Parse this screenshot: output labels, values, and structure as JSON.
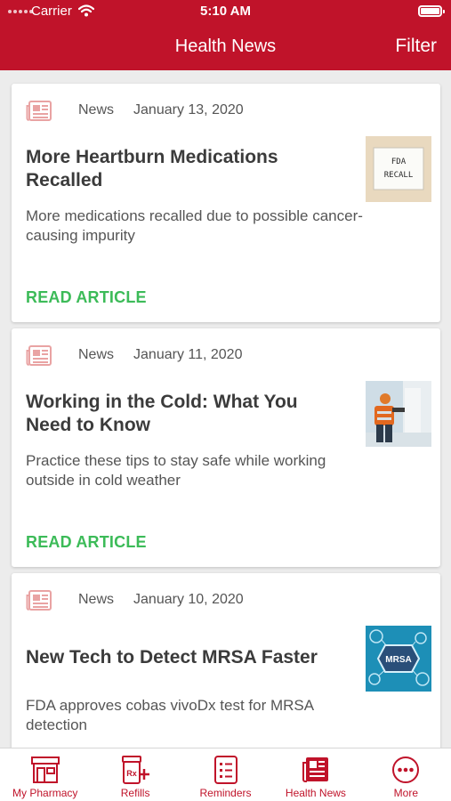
{
  "status": {
    "carrier": "Carrier",
    "time": "5:10 AM"
  },
  "nav": {
    "title": "Health News",
    "filter": "Filter"
  },
  "articles": [
    {
      "source": "News",
      "date": "January 13, 2020",
      "title": "More Heartburn Medications Recalled",
      "summary": "More medications recalled due to possible cancer-causing impurity",
      "cta": "READ ARTICLE",
      "thumb_text_1": "FDA",
      "thumb_text_2": "RECALL"
    },
    {
      "source": "News",
      "date": "January 11, 2020",
      "title": "Working in the Cold: What You Need to Know",
      "summary": "Practice these tips to stay safe while working outside in cold weather",
      "cta": "READ ARTICLE"
    },
    {
      "source": "News",
      "date": "January 10, 2020",
      "title": "New Tech to Detect MRSA Faster",
      "summary": "FDA approves cobas vivoDx test for MRSA detection",
      "thumb_text": "MRSA"
    }
  ],
  "tabs": [
    {
      "label": "My Pharmacy",
      "icon": "storefront-icon"
    },
    {
      "label": "Refills",
      "icon": "rx-refill-icon"
    },
    {
      "label": "Reminders",
      "icon": "checklist-icon"
    },
    {
      "label": "Health News",
      "icon": "newspaper-icon"
    },
    {
      "label": "More",
      "icon": "more-dots-icon"
    }
  ],
  "colors": {
    "brand": "#c0132a",
    "cta": "#3cbb58"
  }
}
